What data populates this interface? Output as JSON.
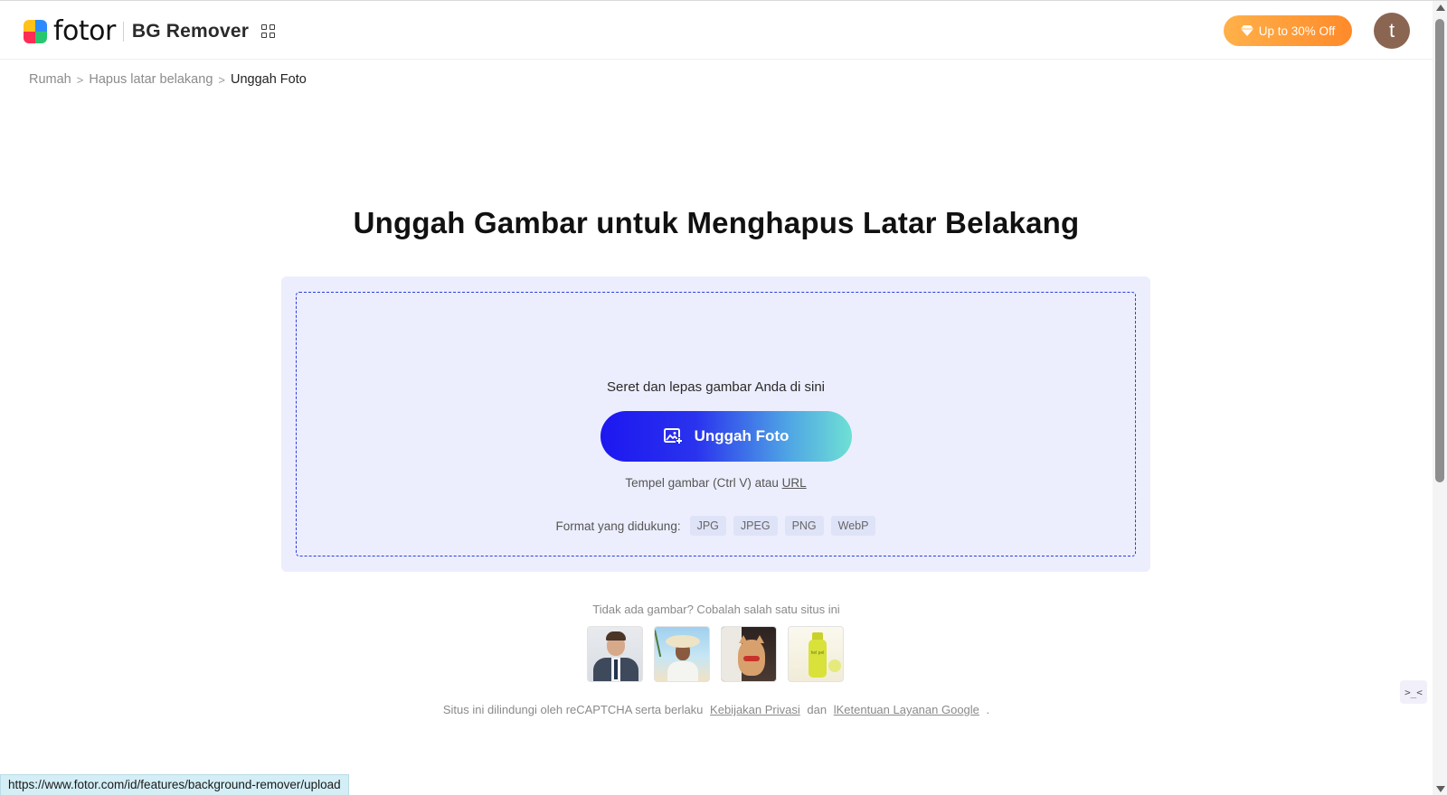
{
  "header": {
    "logo_text": "fotor",
    "product_name": "BG Remover",
    "promo_label": "Up to 30% Off",
    "avatar_initial": "t"
  },
  "breadcrumb": {
    "items": [
      "Rumah",
      "Hapus latar belakang",
      "Unggah Foto"
    ],
    "separator": ">"
  },
  "main": {
    "title": "Unggah Gambar untuk Menghapus Latar Belakang",
    "drag_text": "Seret dan lepas gambar Anda di sini",
    "upload_button": "Unggah Foto",
    "paste_text": "Tempel gambar (Ctrl V) atau",
    "paste_link": "URL",
    "formats_label": "Format yang didukung:",
    "formats": [
      "JPG",
      "JPEG",
      "PNG",
      "WebP"
    ]
  },
  "samples": {
    "label": "Tidak ada gambar? Cobalah salah satu situs ini",
    "items": [
      "sample-man",
      "sample-beach-woman",
      "sample-cat",
      "sample-bottle"
    ],
    "bottle_text": "hel pel"
  },
  "recaptcha": {
    "text": "Situs ini dilindungi oleh reCAPTCHA serta berlaku",
    "privacy_link": "Kebijakan Privasi",
    "connector": "dan",
    "terms_link": "lKetentuan Layanan Google",
    "end": "."
  },
  "side_widget": {
    "label": ">_<"
  },
  "status_bar": {
    "url": "https://www.fotor.com/id/features/background-remover/upload"
  },
  "colors": {
    "brand_blue": "#1c17f0",
    "promo_orange": "#ff8a2a",
    "panel_bg": "#eceefd",
    "dropzone_border": "#2c3be0"
  }
}
